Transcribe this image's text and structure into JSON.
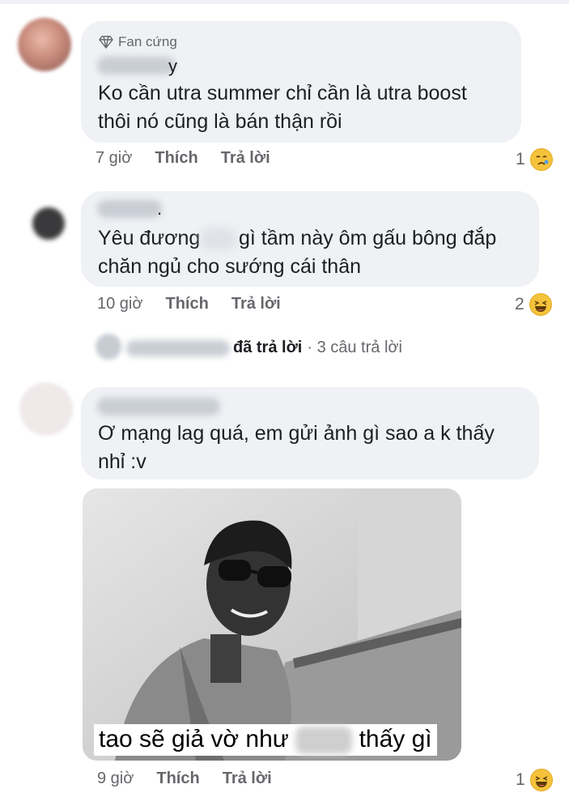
{
  "comments": [
    {
      "badge": "Fan cứng",
      "name_suffix": "y",
      "text_line1": "Ko cần utra summer chỉ cần là utra boost",
      "text_line2": "thôi nó cũng là bán thận rồi",
      "time": "7 giờ",
      "like": "Thích",
      "reply": "Trả lời",
      "reaction_count": "1",
      "reaction_icon": "crying-face-icon"
    },
    {
      "name_suffix": ".",
      "text_line1_a": "Yêu đương",
      "text_line1_b": "gì tầm này ôm gấu bông đắp",
      "text_line2": "chăn ngủ cho sướng cái thân",
      "time": "10 giờ",
      "like": "Thích",
      "reply": "Trả lời",
      "reaction_count": "2",
      "reaction_icon": "laughing-face-icon",
      "replies_summary_a": "đã trả lời",
      "replies_summary_b": "· 3 câu trả lời"
    },
    {
      "text_line1": "Ơ mạng lag quá, em gửi ảnh gì sao a k thấy",
      "text_line2": "nhỉ :v",
      "image_caption_a": "tao sẽ giả vờ như",
      "image_caption_b": "thấy gì",
      "time": "9 giờ",
      "like": "Thích",
      "reply": "Trả lời",
      "reaction_count": "1",
      "reaction_icon": "laughing-face-icon"
    }
  ]
}
